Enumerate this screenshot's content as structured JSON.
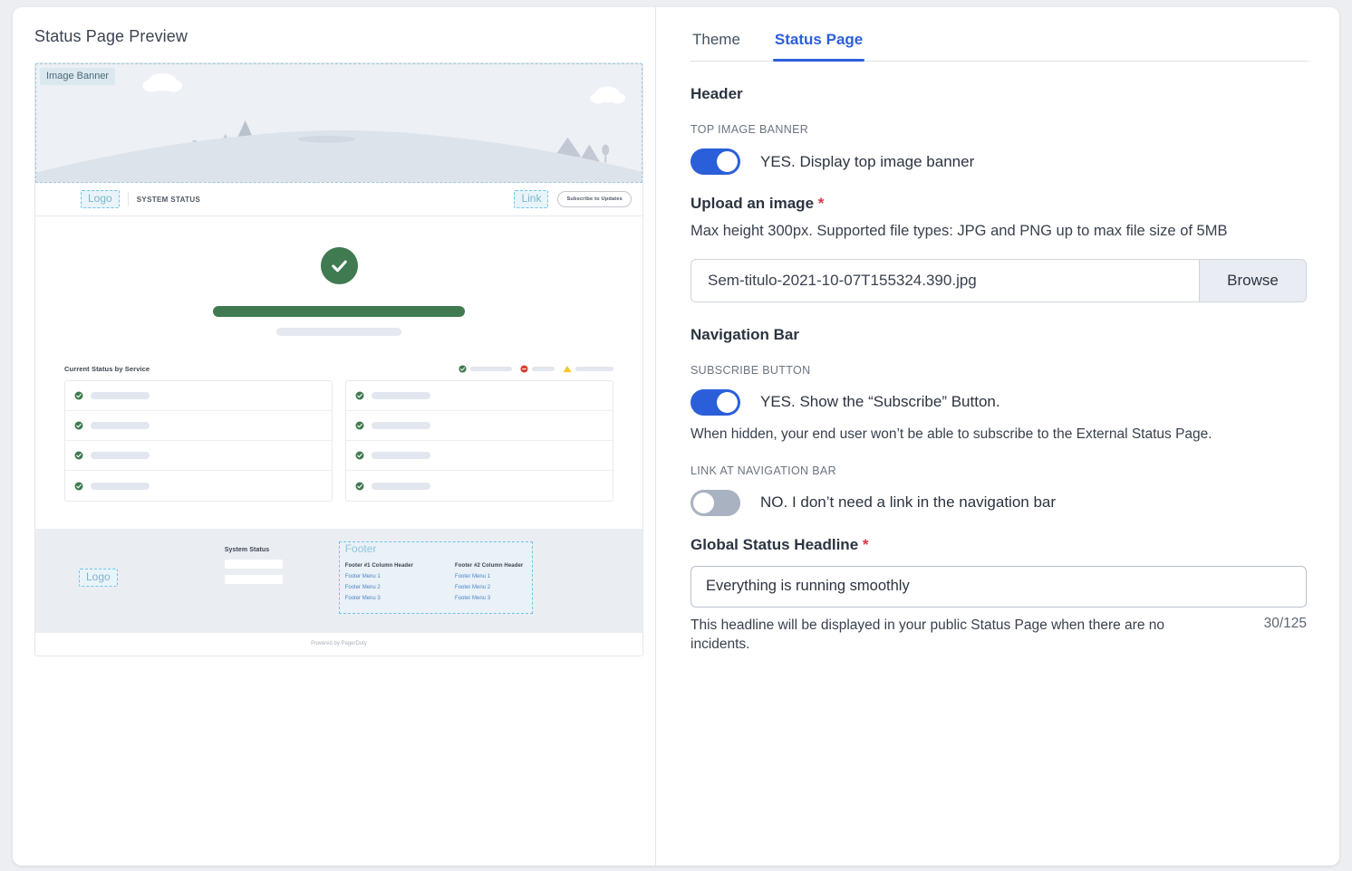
{
  "preview": {
    "title": "Status Page Preview",
    "banner_tag": "Image Banner",
    "nav": {
      "logo_placeholder": "Logo",
      "system_status": "SYSTEM STATUS",
      "link_placeholder": "Link",
      "subscribe_button": "Subscribe to Updates"
    },
    "services": {
      "heading": "Current Status by Service",
      "legend": [
        "operational-icon",
        "major-outage-icon",
        "degraded-icon"
      ],
      "row_count_per_column": 4,
      "column_count": 2
    },
    "footer": {
      "logo_placeholder": "Logo",
      "system_status_title": "System Status",
      "tag": "Footer",
      "columns": [
        {
          "header": "Footer #1 Column Header",
          "links": [
            "Footer Menu 1",
            "Footer Menu 2",
            "Footer Menu 3"
          ]
        },
        {
          "header": "Footer #2 Column Header",
          "links": [
            "Footer Menu 1",
            "Footer Menu 2",
            "Footer Menu 3"
          ]
        }
      ],
      "powered_by": "Powered by PagerDuty"
    }
  },
  "settings": {
    "tabs": [
      {
        "label": "Theme",
        "active": false
      },
      {
        "label": "Status Page",
        "active": true
      }
    ],
    "header_section": {
      "title": "Header",
      "top_image_banner_label": "TOP IMAGE BANNER",
      "top_image_banner_toggle": {
        "state": "on",
        "text": "YES. Display top image banner"
      },
      "upload_label": "Upload an image",
      "upload_required_mark": "*",
      "upload_help": "Max height 300px. Supported file types: JPG and PNG up to max file size of 5MB",
      "file_name": "Sem-titulo-2021-10-07T155324.390.jpg",
      "browse_label": "Browse"
    },
    "nav_section": {
      "title": "Navigation Bar",
      "subscribe_label": "SUBSCRIBE BUTTON",
      "subscribe_toggle": {
        "state": "on",
        "text": "YES. Show the “Subscribe” Button."
      },
      "subscribe_note": "When hidden, your end user won’t be able to subscribe to the External Status Page.",
      "link_label": "LINK AT NAVIGATION BAR",
      "link_toggle": {
        "state": "off",
        "text": "NO. I don’t need a link in the navigation bar"
      }
    },
    "headline_section": {
      "label": "Global Status Headline",
      "required_mark": "*",
      "value": "Everything is running smoothly",
      "placeholder": "Everything is running smoothly",
      "help": "This headline will be displayed in your public Status Page when there are no incidents.",
      "counter": "30/125"
    }
  },
  "colors": {
    "accent_blue": "#2b5fd9",
    "toggle_off": "#a8b2c1",
    "status_green": "#3f7a50",
    "status_red": "#d64232",
    "status_yellow": "#f5c828",
    "required_red": "#d6374b",
    "dashed_blue": "#6fc3e8"
  }
}
